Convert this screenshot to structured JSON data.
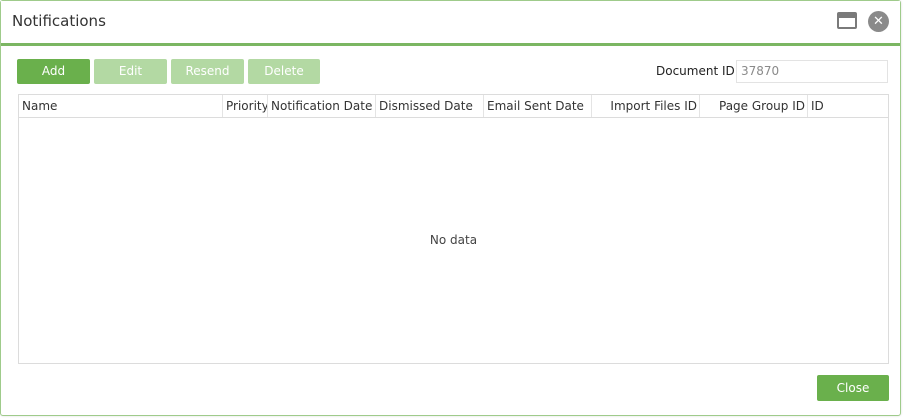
{
  "dialog": {
    "title": "Notifications"
  },
  "toolbar": {
    "add_label": "Add",
    "edit_label": "Edit",
    "resend_label": "Resend",
    "delete_label": "Delete"
  },
  "document": {
    "label": "Document ID:",
    "value": "37870"
  },
  "grid": {
    "columns": [
      "Name",
      "Priority",
      "Notification Date",
      "Dismissed Date",
      "Email Sent Date",
      "Import Files ID",
      "Page Group ID",
      "ID"
    ],
    "empty_text": "No data"
  },
  "footer": {
    "close_label": "Close"
  },
  "colors": {
    "accent": "#6ab04c",
    "accent_disabled": "#b3d9a3",
    "border": "#7bb662"
  },
  "icons": {
    "maximize": "maximize-icon",
    "close": "close-circle-icon"
  }
}
